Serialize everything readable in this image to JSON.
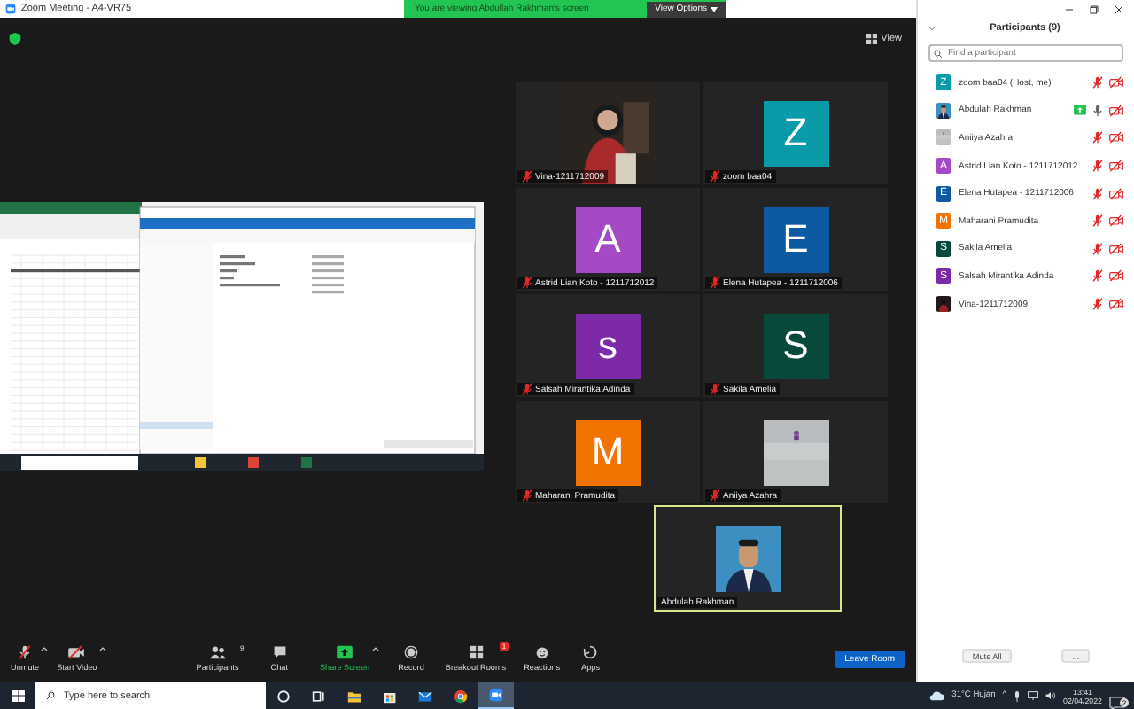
{
  "window": {
    "title": "Zoom Meeting - A4-VR75",
    "banner": "You are viewing Abdullah Rakhman's screen",
    "view_options": "View Options",
    "view_button": "View"
  },
  "tiles": [
    {
      "kind": "video",
      "name": "Vina-1211712009",
      "muted": true,
      "active": false
    },
    {
      "kind": "avatar",
      "letter": "Z",
      "color": "#0a9ba8",
      "name": "zoom baa04",
      "muted": true,
      "active": false
    },
    {
      "kind": "avatar",
      "letter": "A",
      "color": "#a54ac4",
      "name": "Astrid Lian Koto - 1211712012",
      "muted": true,
      "active": false
    },
    {
      "kind": "avatar",
      "letter": "E",
      "color": "#0b5aa2",
      "name": "Elena Hutapea - 1211712006",
      "muted": true,
      "active": false
    },
    {
      "kind": "avatar",
      "letter": "s",
      "color": "#7d2aa8",
      "name": "Salsah Mirantika Adinda",
      "muted": true,
      "active": false
    },
    {
      "kind": "avatar",
      "letter": "S",
      "color": "#08493b",
      "name": "Sakila Amelia",
      "muted": true,
      "active": false
    },
    {
      "kind": "avatar",
      "letter": "M",
      "color": "#f27300",
      "name": "Maharani Pramudita",
      "muted": true,
      "active": false
    },
    {
      "name": "Aniiya Azahra",
      "muted": true,
      "active": false
    },
    {
      "name": "Abdulah Rakhman",
      "muted": false,
      "active": true
    }
  ],
  "participants": {
    "title": "Participants (9)",
    "search": {
      "placeholder": "Find a participant"
    },
    "rows": [
      {
        "kind": "avatar",
        "letter": "Z",
        "color": "#0a9ba8",
        "name": "zoom baa04 (Host, me)",
        "sharing": false,
        "muted": true,
        "video_on": false
      },
      {
        "name": "Abdulah Rakhman",
        "sharing": true,
        "muted": false,
        "video_on": false
      },
      {
        "name": "Aniiya Azahra",
        "sharing": false,
        "muted": true,
        "video_on": false
      },
      {
        "kind": "avatar",
        "letter": "A",
        "color": "#a54ac4",
        "name": "Astrid Lian Koto - 1211712012",
        "sharing": false,
        "muted": true,
        "video_on": false
      },
      {
        "kind": "avatar",
        "letter": "E",
        "color": "#0b5aa2",
        "name": "Elena Hutapea - 1211712006",
        "sharing": false,
        "muted": true,
        "video_on": false
      },
      {
        "kind": "avatar",
        "letter": "M",
        "color": "#f27300",
        "name": "Maharani Pramudita",
        "sharing": false,
        "muted": true,
        "video_on": false
      },
      {
        "kind": "avatar",
        "letter": "S",
        "color": "#08493b",
        "name": "Sakila Amelia",
        "sharing": false,
        "muted": true,
        "video_on": false
      },
      {
        "kind": "avatar",
        "letter": "S",
        "color": "#7d2aa8",
        "name": "Salsah Mirantika Adinda",
        "sharing": false,
        "muted": true,
        "video_on": false
      },
      {
        "name": "Vina-1211712009",
        "sharing": false,
        "muted": true,
        "video_on": false
      }
    ],
    "mute_all": "Mute All",
    "more": "..."
  },
  "toolbar": [
    {
      "kind": "unmute",
      "label": "Unmute",
      "caret": true
    },
    {
      "kind": "video",
      "label": "Start Video",
      "caret": true
    },
    {
      "kind": "participants",
      "label": "Participants",
      "count": "9",
      "caret": false
    },
    {
      "kind": "chat",
      "label": "Chat",
      "caret": false
    },
    {
      "kind": "share",
      "label": "Share Screen",
      "caret": true
    },
    {
      "kind": "record",
      "label": "Record",
      "caret": false
    },
    {
      "kind": "breakout",
      "label": "Breakout Rooms",
      "badge": "1",
      "caret": false
    },
    {
      "kind": "reactions",
      "label": "Reactions",
      "caret": false
    },
    {
      "kind": "apps",
      "label": "Apps",
      "caret": false
    }
  ],
  "leave_button": "Leave Room",
  "taskbar": {
    "search": {
      "placeholder": "Type here to search"
    },
    "apps": [
      {
        "kind": "cortana",
        "active": false
      },
      {
        "kind": "taskview",
        "active": false
      },
      {
        "kind": "explorer",
        "active": false
      },
      {
        "kind": "store",
        "active": false
      },
      {
        "kind": "mail",
        "active": false
      },
      {
        "kind": "chrome",
        "active": false
      },
      {
        "kind": "zoom",
        "active": true
      }
    ],
    "weather": "31°C  Hujan",
    "chevron": "^",
    "time": "13:41",
    "date": "02/04/2022",
    "notifications": "2"
  }
}
